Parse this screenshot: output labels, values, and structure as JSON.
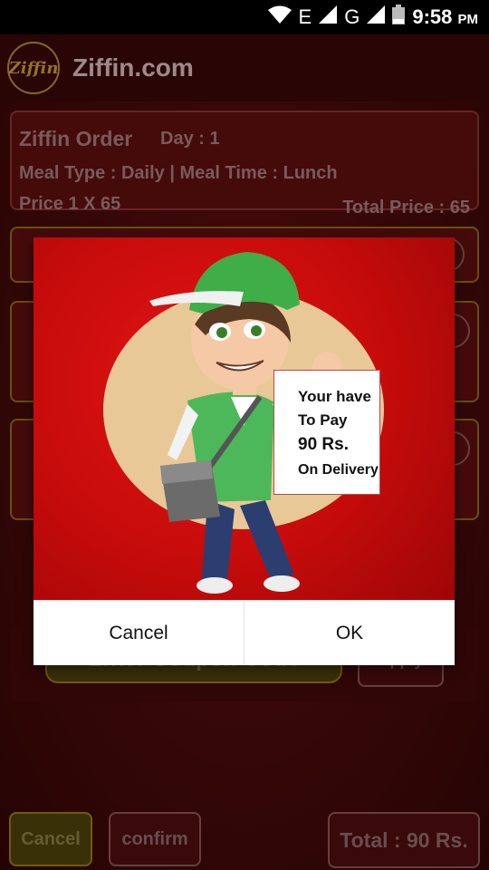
{
  "status_bar": {
    "network_e": "E",
    "network_g": "G",
    "time": "9:58",
    "ampm": "PM",
    "icons": [
      "wifi-icon",
      "signal-icon",
      "signal-icon",
      "battery-icon"
    ]
  },
  "app_bar": {
    "logo_text": "Ziffin",
    "title": "Ziffin.com"
  },
  "order": {
    "name": "Ziffin Order",
    "day": "Day : 1",
    "meal_line": "Meal Type  :  Daily  |   Meal Time  :  Lunch",
    "price_line": "Price    1   X 65",
    "total": "Total Price : 65"
  },
  "coupon": {
    "placeholder": "Enter Coupon Code",
    "apply_label": "Apply"
  },
  "bottom_bar": {
    "cancel_label": "Cancel",
    "confirm_label": "confirm",
    "total_label": "Total : 90 Rs."
  },
  "dialog": {
    "note_line1": "Your have",
    "note_line2": "To Pay",
    "note_line3": "90 Rs.",
    "note_line4": "On Delivery",
    "cancel_label": "Cancel",
    "ok_label": "OK"
  },
  "colors": {
    "brand_red": "#c50b0b",
    "dark_red": "#3f0808",
    "gold": "#a88c1a"
  }
}
